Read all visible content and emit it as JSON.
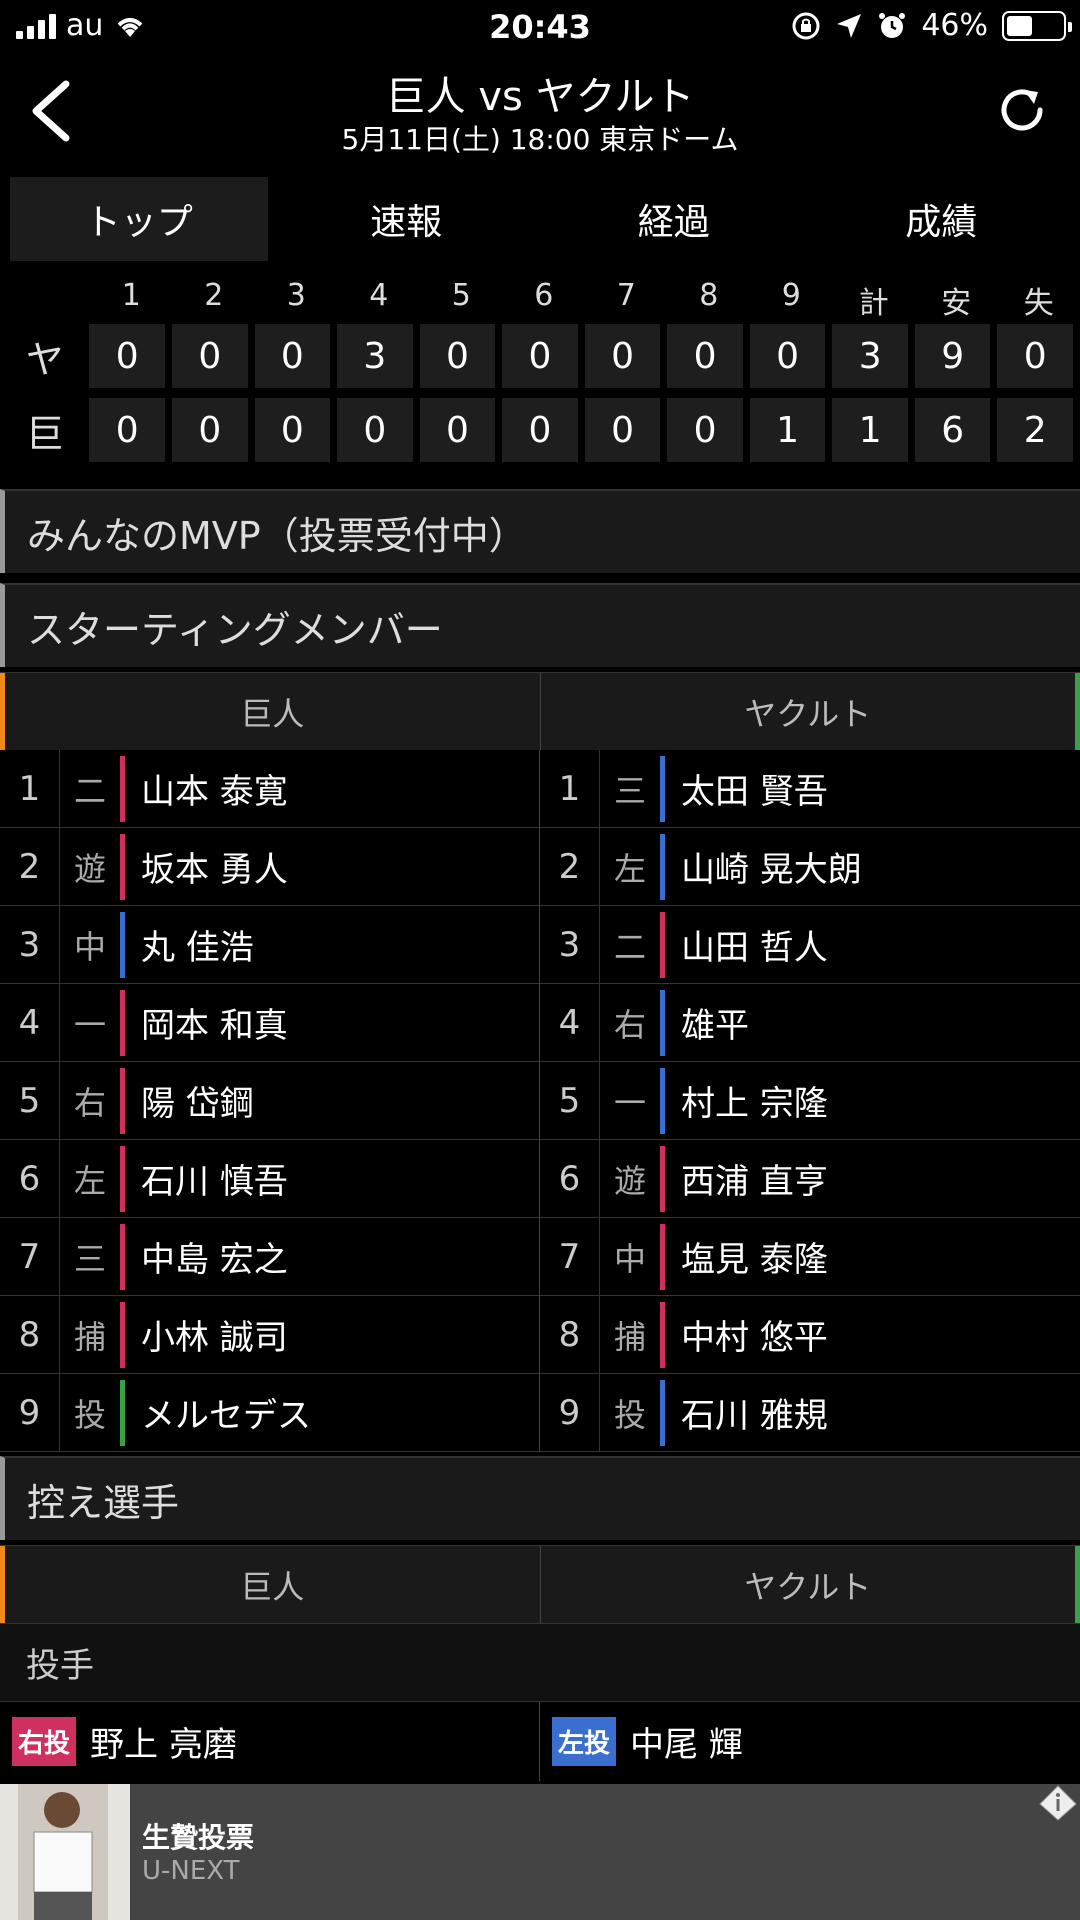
{
  "status_bar": {
    "carrier": "au",
    "time": "20:43",
    "battery": "46%",
    "battery_level": 0.46
  },
  "header": {
    "title": "巨人 vs ヤクルト",
    "subtitle": "5月11日(土) 18:00 東京ドーム"
  },
  "tabs": [
    {
      "label": "トップ",
      "active": true
    },
    {
      "label": "速報",
      "active": false
    },
    {
      "label": "経過",
      "active": false
    },
    {
      "label": "成績",
      "active": false
    }
  ],
  "scoreboard": {
    "columns": [
      "1",
      "2",
      "3",
      "4",
      "5",
      "6",
      "7",
      "8",
      "9",
      "計",
      "安",
      "失"
    ],
    "rows": [
      {
        "team": "ヤ",
        "values": [
          "0",
          "0",
          "0",
          "3",
          "0",
          "0",
          "0",
          "0",
          "0",
          "3",
          "9",
          "0"
        ]
      },
      {
        "team": "巨",
        "values": [
          "0",
          "0",
          "0",
          "0",
          "0",
          "0",
          "0",
          "0",
          "1",
          "1",
          "6",
          "2"
        ]
      }
    ]
  },
  "sections": {
    "mvp": "みんなのMVP（投票受付中）",
    "starting": "スターティングメンバー",
    "bench": "控え選手"
  },
  "teams": {
    "home": "巨人",
    "away": "ヤクルト"
  },
  "lineup": {
    "home": [
      {
        "num": "1",
        "pos": "二",
        "name": "山本 泰寛",
        "bar": "#d03060"
      },
      {
        "num": "2",
        "pos": "遊",
        "name": "坂本 勇人",
        "bar": "#d03060"
      },
      {
        "num": "3",
        "pos": "中",
        "name": "丸 佳浩",
        "bar": "#3a6fd0"
      },
      {
        "num": "4",
        "pos": "一",
        "name": "岡本 和真",
        "bar": "#d03060"
      },
      {
        "num": "5",
        "pos": "右",
        "name": "陽 岱鋼",
        "bar": "#d03060"
      },
      {
        "num": "6",
        "pos": "左",
        "name": "石川 慎吾",
        "bar": "#d03060"
      },
      {
        "num": "7",
        "pos": "三",
        "name": "中島 宏之",
        "bar": "#d03060"
      },
      {
        "num": "8",
        "pos": "捕",
        "name": "小林 誠司",
        "bar": "#d03060"
      },
      {
        "num": "9",
        "pos": "投",
        "name": "メルセデス",
        "bar": "#3aa14a"
      }
    ],
    "away": [
      {
        "num": "1",
        "pos": "三",
        "name": "太田 賢吾",
        "bar": "#3a6fd0"
      },
      {
        "num": "2",
        "pos": "左",
        "name": "山崎 晃大朗",
        "bar": "#3a6fd0"
      },
      {
        "num": "3",
        "pos": "二",
        "name": "山田 哲人",
        "bar": "#d03060"
      },
      {
        "num": "4",
        "pos": "右",
        "name": "雄平",
        "bar": "#3a6fd0"
      },
      {
        "num": "5",
        "pos": "一",
        "name": "村上 宗隆",
        "bar": "#3a6fd0"
      },
      {
        "num": "6",
        "pos": "遊",
        "name": "西浦 直亨",
        "bar": "#d03060"
      },
      {
        "num": "7",
        "pos": "中",
        "name": "塩見 泰隆",
        "bar": "#d03060"
      },
      {
        "num": "8",
        "pos": "捕",
        "name": "中村 悠平",
        "bar": "#d03060"
      },
      {
        "num": "9",
        "pos": "投",
        "name": "石川 雅規",
        "bar": "#3a6fd0"
      }
    ]
  },
  "bench": {
    "pitcher_label": "投手",
    "home_pitcher": {
      "tag": "右投",
      "name": "野上 亮磨",
      "color": "#d03060"
    },
    "away_pitcher": {
      "tag": "左投",
      "name": "中尾 輝",
      "color": "#3a6fd0"
    }
  },
  "ad": {
    "title": "生贄投票",
    "sponsor": "U-NEXT"
  },
  "colors": {
    "giants": "#f08a1c",
    "swallows": "#3aa14a"
  }
}
